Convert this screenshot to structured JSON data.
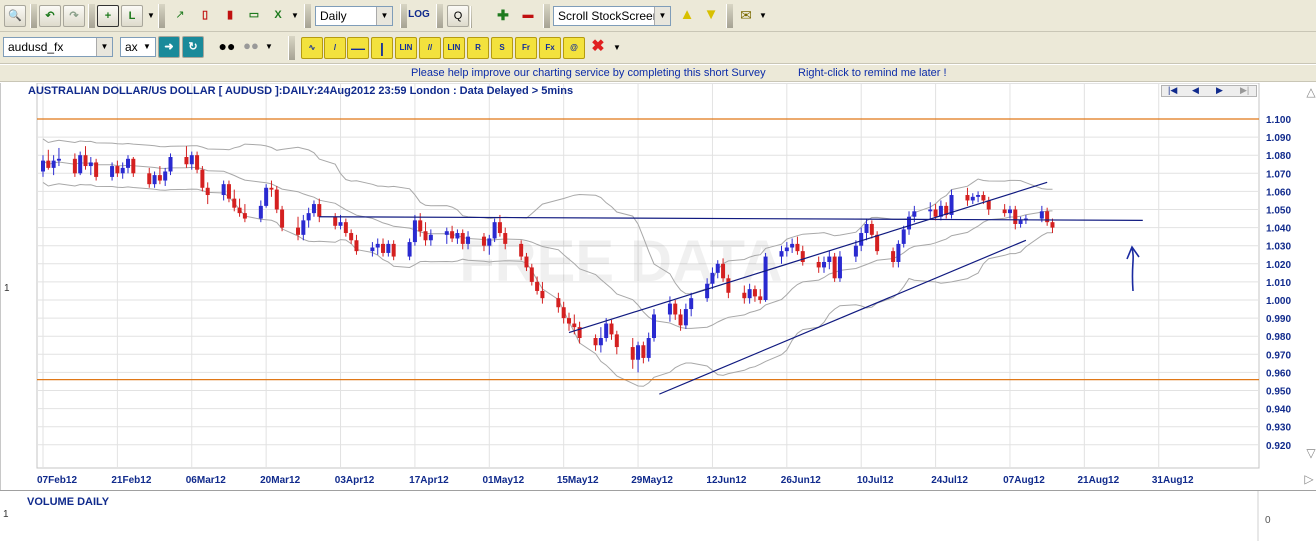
{
  "toolbar1": {
    "period_select": "Daily",
    "log_label": "LOG",
    "scroll_select": "Scroll StockScreen"
  },
  "toolbar2": {
    "symbol_input": "audusd_fx",
    "exchange_select": "ax",
    "draw_buttons": [
      "LIN",
      "LIN",
      "R",
      "S",
      "Fr",
      "Fx"
    ]
  },
  "survey": {
    "message": "Please help improve our charting service by completing this short Survey",
    "remind": "Right-click to remind me later !"
  },
  "chart": {
    "title": "AUSTRALIAN DOLLAR/US DOLLAR [ AUDUSD ]:DAILY:24Aug2012 23:59 London : Data Delayed > 5mins",
    "watermark": "FREE DATA",
    "left_marker": "1"
  },
  "volume": {
    "title": "VOLUME DAILY",
    "left_marker": "1",
    "right_value": "0"
  },
  "chart_data": {
    "type": "candlestick",
    "title": "AUSTRALIAN DOLLAR/US DOLLAR [ AUDUSD ]:DAILY:24Aug2012 23:59 London : Data Delayed > 5mins",
    "x_tick_labels": [
      "07Feb12",
      "21Feb12",
      "06Mar12",
      "20Mar12",
      "03Apr12",
      "17Apr12",
      "01May12",
      "15May12",
      "29May12",
      "12Jun12",
      "26Jun12",
      "10Jul12",
      "24Jul12",
      "07Aug12",
      "21Aug12",
      "31Aug12"
    ],
    "y_tick_labels": [
      "1.100",
      "1.090",
      "1.080",
      "1.070",
      "1.060",
      "1.050",
      "1.040",
      "1.030",
      "1.020",
      "1.010",
      "1.000",
      "0.990",
      "0.980",
      "0.970",
      "0.960",
      "0.950",
      "0.940",
      "0.930",
      "0.920"
    ],
    "ylim": [
      0.915,
      1.105
    ],
    "x_range_days": [
      0,
      210
    ],
    "grid": true,
    "up_color": "#2a2ad0",
    "down_color": "#d42020",
    "band_color": "#a8a8a8",
    "trendline_color": "#101a80",
    "level_color": "#e07818",
    "horizontal_levels": [
      1.1,
      0.956
    ],
    "trendlines": [
      {
        "x1": 99,
        "y1": 0.982,
        "x2": 189,
        "y2": 1.065
      },
      {
        "x1": 116,
        "y1": 0.948,
        "x2": 185,
        "y2": 1.033
      },
      {
        "x1": 52,
        "y1": 1.046,
        "x2": 207,
        "y2": 1.044
      }
    ],
    "ohlc": [
      {
        "t": 0,
        "o": 1.071,
        "h": 1.08,
        "l": 1.068,
        "c": 1.077
      },
      {
        "t": 1,
        "o": 1.077,
        "h": 1.083,
        "l": 1.072,
        "c": 1.073
      },
      {
        "t": 2,
        "o": 1.073,
        "h": 1.08,
        "l": 1.069,
        "c": 1.077
      },
      {
        "t": 3,
        "o": 1.077,
        "h": 1.084,
        "l": 1.074,
        "c": 1.078
      },
      {
        "t": 6,
        "o": 1.078,
        "h": 1.081,
        "l": 1.068,
        "c": 1.07
      },
      {
        "t": 7,
        "o": 1.07,
        "h": 1.082,
        "l": 1.069,
        "c": 1.08
      },
      {
        "t": 8,
        "o": 1.08,
        "h": 1.085,
        "l": 1.072,
        "c": 1.074
      },
      {
        "t": 9,
        "o": 1.074,
        "h": 1.079,
        "l": 1.069,
        "c": 1.076
      },
      {
        "t": 10,
        "o": 1.076,
        "h": 1.078,
        "l": 1.066,
        "c": 1.068
      },
      {
        "t": 13,
        "o": 1.068,
        "h": 1.076,
        "l": 1.066,
        "c": 1.074
      },
      {
        "t": 14,
        "o": 1.074,
        "h": 1.077,
        "l": 1.068,
        "c": 1.07
      },
      {
        "t": 15,
        "o": 1.07,
        "h": 1.076,
        "l": 1.067,
        "c": 1.073
      },
      {
        "t": 16,
        "o": 1.073,
        "h": 1.08,
        "l": 1.07,
        "c": 1.078
      },
      {
        "t": 17,
        "o": 1.078,
        "h": 1.079,
        "l": 1.068,
        "c": 1.07
      },
      {
        "t": 20,
        "o": 1.07,
        "h": 1.073,
        "l": 1.062,
        "c": 1.064
      },
      {
        "t": 21,
        "o": 1.064,
        "h": 1.071,
        "l": 1.062,
        "c": 1.069
      },
      {
        "t": 22,
        "o": 1.069,
        "h": 1.074,
        "l": 1.064,
        "c": 1.066
      },
      {
        "t": 23,
        "o": 1.066,
        "h": 1.073,
        "l": 1.063,
        "c": 1.071
      },
      {
        "t": 24,
        "o": 1.071,
        "h": 1.081,
        "l": 1.069,
        "c": 1.079
      },
      {
        "t": 27,
        "o": 1.079,
        "h": 1.085,
        "l": 1.073,
        "c": 1.075
      },
      {
        "t": 28,
        "o": 1.075,
        "h": 1.082,
        "l": 1.072,
        "c": 1.08
      },
      {
        "t": 29,
        "o": 1.08,
        "h": 1.082,
        "l": 1.07,
        "c": 1.072
      },
      {
        "t": 30,
        "o": 1.072,
        "h": 1.074,
        "l": 1.06,
        "c": 1.062
      },
      {
        "t": 31,
        "o": 1.062,
        "h": 1.065,
        "l": 1.053,
        "c": 1.058
      },
      {
        "t": 34,
        "o": 1.058,
        "h": 1.066,
        "l": 1.055,
        "c": 1.064
      },
      {
        "t": 35,
        "o": 1.064,
        "h": 1.066,
        "l": 1.054,
        "c": 1.056
      },
      {
        "t": 36,
        "o": 1.056,
        "h": 1.061,
        "l": 1.049,
        "c": 1.051
      },
      {
        "t": 37,
        "o": 1.051,
        "h": 1.056,
        "l": 1.046,
        "c": 1.048
      },
      {
        "t": 38,
        "o": 1.048,
        "h": 1.053,
        "l": 1.043,
        "c": 1.045
      },
      {
        "t": 41,
        "o": 1.045,
        "h": 1.055,
        "l": 1.043,
        "c": 1.052
      },
      {
        "t": 42,
        "o": 1.052,
        "h": 1.064,
        "l": 1.051,
        "c": 1.062
      },
      {
        "t": 43,
        "o": 1.062,
        "h": 1.066,
        "l": 1.057,
        "c": 1.061
      },
      {
        "t": 44,
        "o": 1.061,
        "h": 1.063,
        "l": 1.048,
        "c": 1.05
      },
      {
        "t": 45,
        "o": 1.05,
        "h": 1.052,
        "l": 1.038,
        "c": 1.04
      },
      {
        "t": 48,
        "o": 1.04,
        "h": 1.046,
        "l": 1.033,
        "c": 1.036
      },
      {
        "t": 49,
        "o": 1.036,
        "h": 1.047,
        "l": 1.033,
        "c": 1.044
      },
      {
        "t": 50,
        "o": 1.044,
        "h": 1.051,
        "l": 1.04,
        "c": 1.048
      },
      {
        "t": 51,
        "o": 1.048,
        "h": 1.055,
        "l": 1.046,
        "c": 1.053
      },
      {
        "t": 52,
        "o": 1.053,
        "h": 1.056,
        "l": 1.043,
        "c": 1.046
      },
      {
        "t": 55,
        "o": 1.046,
        "h": 1.048,
        "l": 1.039,
        "c": 1.041
      },
      {
        "t": 56,
        "o": 1.041,
        "h": 1.047,
        "l": 1.039,
        "c": 1.043
      },
      {
        "t": 57,
        "o": 1.043,
        "h": 1.045,
        "l": 1.035,
        "c": 1.037
      },
      {
        "t": 58,
        "o": 1.037,
        "h": 1.039,
        "l": 1.031,
        "c": 1.033
      },
      {
        "t": 59,
        "o": 1.033,
        "h": 1.036,
        "l": 1.025,
        "c": 1.027
      },
      {
        "t": 62,
        "o": 1.027,
        "h": 1.032,
        "l": 1.024,
        "c": 1.029
      },
      {
        "t": 63,
        "o": 1.029,
        "h": 1.034,
        "l": 1.025,
        "c": 1.031
      },
      {
        "t": 64,
        "o": 1.031,
        "h": 1.034,
        "l": 1.024,
        "c": 1.026
      },
      {
        "t": 65,
        "o": 1.026,
        "h": 1.033,
        "l": 1.024,
        "c": 1.031
      },
      {
        "t": 66,
        "o": 1.031,
        "h": 1.033,
        "l": 1.022,
        "c": 1.024
      },
      {
        "t": 69,
        "o": 1.024,
        "h": 1.034,
        "l": 1.022,
        "c": 1.032
      },
      {
        "t": 70,
        "o": 1.032,
        "h": 1.047,
        "l": 1.03,
        "c": 1.044
      },
      {
        "t": 71,
        "o": 1.044,
        "h": 1.048,
        "l": 1.035,
        "c": 1.038
      },
      {
        "t": 72,
        "o": 1.038,
        "h": 1.043,
        "l": 1.03,
        "c": 1.033
      },
      {
        "t": 73,
        "o": 1.033,
        "h": 1.039,
        "l": 1.03,
        "c": 1.036
      },
      {
        "t": 76,
        "o": 1.036,
        "h": 1.04,
        "l": 1.031,
        "c": 1.038
      },
      {
        "t": 77,
        "o": 1.038,
        "h": 1.041,
        "l": 1.032,
        "c": 1.034
      },
      {
        "t": 78,
        "o": 1.034,
        "h": 1.039,
        "l": 1.031,
        "c": 1.037
      },
      {
        "t": 79,
        "o": 1.037,
        "h": 1.039,
        "l": 1.028,
        "c": 1.031
      },
      {
        "t": 80,
        "o": 1.031,
        "h": 1.038,
        "l": 1.028,
        "c": 1.035
      },
      {
        "t": 83,
        "o": 1.035,
        "h": 1.037,
        "l": 1.027,
        "c": 1.03
      },
      {
        "t": 84,
        "o": 1.03,
        "h": 1.036,
        "l": 1.025,
        "c": 1.034
      },
      {
        "t": 85,
        "o": 1.034,
        "h": 1.045,
        "l": 1.032,
        "c": 1.043
      },
      {
        "t": 86,
        "o": 1.043,
        "h": 1.047,
        "l": 1.035,
        "c": 1.037
      },
      {
        "t": 87,
        "o": 1.037,
        "h": 1.04,
        "l": 1.028,
        "c": 1.031
      },
      {
        "t": 90,
        "o": 1.031,
        "h": 1.033,
        "l": 1.022,
        "c": 1.024
      },
      {
        "t": 91,
        "o": 1.024,
        "h": 1.026,
        "l": 1.016,
        "c": 1.018
      },
      {
        "t": 92,
        "o": 1.018,
        "h": 1.02,
        "l": 1.008,
        "c": 1.01
      },
      {
        "t": 93,
        "o": 1.01,
        "h": 1.013,
        "l": 1.003,
        "c": 1.005
      },
      {
        "t": 94,
        "o": 1.005,
        "h": 1.01,
        "l": 0.998,
        "c": 1.001
      },
      {
        "t": 97,
        "o": 1.001,
        "h": 1.004,
        "l": 0.993,
        "c": 0.996
      },
      {
        "t": 98,
        "o": 0.996,
        "h": 0.999,
        "l": 0.987,
        "c": 0.99
      },
      {
        "t": 99,
        "o": 0.99,
        "h": 0.993,
        "l": 0.983,
        "c": 0.987
      },
      {
        "t": 100,
        "o": 0.987,
        "h": 0.992,
        "l": 0.981,
        "c": 0.985
      },
      {
        "t": 101,
        "o": 0.985,
        "h": 0.988,
        "l": 0.976,
        "c": 0.979
      },
      {
        "t": 104,
        "o": 0.979,
        "h": 0.981,
        "l": 0.972,
        "c": 0.975
      },
      {
        "t": 105,
        "o": 0.975,
        "h": 0.985,
        "l": 0.971,
        "c": 0.979
      },
      {
        "t": 106,
        "o": 0.979,
        "h": 0.99,
        "l": 0.977,
        "c": 0.987
      },
      {
        "t": 107,
        "o": 0.987,
        "h": 0.989,
        "l": 0.978,
        "c": 0.981
      },
      {
        "t": 108,
        "o": 0.981,
        "h": 0.983,
        "l": 0.97,
        "c": 0.974
      },
      {
        "t": 111,
        "o": 0.974,
        "h": 0.979,
        "l": 0.962,
        "c": 0.967
      },
      {
        "t": 112,
        "o": 0.967,
        "h": 0.977,
        "l": 0.96,
        "c": 0.975
      },
      {
        "t": 113,
        "o": 0.975,
        "h": 0.977,
        "l": 0.965,
        "c": 0.968
      },
      {
        "t": 114,
        "o": 0.968,
        "h": 0.982,
        "l": 0.966,
        "c": 0.979
      },
      {
        "t": 115,
        "o": 0.979,
        "h": 0.995,
        "l": 0.977,
        "c": 0.992
      },
      {
        "t": 118,
        "o": 0.992,
        "h": 1.002,
        "l": 0.988,
        "c": 0.998
      },
      {
        "t": 119,
        "o": 0.998,
        "h": 1.0,
        "l": 0.989,
        "c": 0.992
      },
      {
        "t": 120,
        "o": 0.992,
        "h": 0.995,
        "l": 0.983,
        "c": 0.986
      },
      {
        "t": 121,
        "o": 0.986,
        "h": 0.998,
        "l": 0.984,
        "c": 0.995
      },
      {
        "t": 122,
        "o": 0.995,
        "h": 1.004,
        "l": 0.991,
        "c": 1.001
      },
      {
        "t": 125,
        "o": 1.001,
        "h": 1.012,
        "l": 0.999,
        "c": 1.009
      },
      {
        "t": 126,
        "o": 1.009,
        "h": 1.018,
        "l": 1.006,
        "c": 1.015
      },
      {
        "t": 127,
        "o": 1.015,
        "h": 1.022,
        "l": 1.012,
        "c": 1.02
      },
      {
        "t": 128,
        "o": 1.02,
        "h": 1.023,
        "l": 1.01,
        "c": 1.012
      },
      {
        "t": 129,
        "o": 1.012,
        "h": 1.014,
        "l": 1.001,
        "c": 1.004
      },
      {
        "t": 132,
        "o": 1.004,
        "h": 1.008,
        "l": 0.998,
        "c": 1.001
      },
      {
        "t": 133,
        "o": 1.001,
        "h": 1.009,
        "l": 0.998,
        "c": 1.006
      },
      {
        "t": 134,
        "o": 1.006,
        "h": 1.008,
        "l": 0.999,
        "c": 1.002
      },
      {
        "t": 135,
        "o": 1.002,
        "h": 1.006,
        "l": 0.998,
        "c": 1.0
      },
      {
        "t": 136,
        "o": 1.0,
        "h": 1.026,
        "l": 0.999,
        "c": 1.024
      },
      {
        "t": 139,
        "o": 1.024,
        "h": 1.03,
        "l": 1.02,
        "c": 1.027
      },
      {
        "t": 140,
        "o": 1.027,
        "h": 1.032,
        "l": 1.024,
        "c": 1.029
      },
      {
        "t": 141,
        "o": 1.029,
        "h": 1.034,
        "l": 1.026,
        "c": 1.031
      },
      {
        "t": 142,
        "o": 1.031,
        "h": 1.035,
        "l": 1.025,
        "c": 1.027
      },
      {
        "t": 143,
        "o": 1.027,
        "h": 1.03,
        "l": 1.019,
        "c": 1.021
      },
      {
        "t": 146,
        "o": 1.021,
        "h": 1.024,
        "l": 1.015,
        "c": 1.018
      },
      {
        "t": 147,
        "o": 1.018,
        "h": 1.024,
        "l": 1.015,
        "c": 1.021
      },
      {
        "t": 148,
        "o": 1.021,
        "h": 1.027,
        "l": 1.017,
        "c": 1.024
      },
      {
        "t": 149,
        "o": 1.024,
        "h": 1.026,
        "l": 1.01,
        "c": 1.012
      },
      {
        "t": 150,
        "o": 1.012,
        "h": 1.027,
        "l": 1.01,
        "c": 1.024
      },
      {
        "t": 153,
        "o": 1.024,
        "h": 1.033,
        "l": 1.021,
        "c": 1.03
      },
      {
        "t": 154,
        "o": 1.03,
        "h": 1.04,
        "l": 1.027,
        "c": 1.037
      },
      {
        "t": 155,
        "o": 1.037,
        "h": 1.045,
        "l": 1.033,
        "c": 1.042
      },
      {
        "t": 156,
        "o": 1.042,
        "h": 1.044,
        "l": 1.034,
        "c": 1.036
      },
      {
        "t": 157,
        "o": 1.036,
        "h": 1.038,
        "l": 1.025,
        "c": 1.027
      },
      {
        "t": 160,
        "o": 1.027,
        "h": 1.029,
        "l": 1.018,
        "c": 1.021
      },
      {
        "t": 161,
        "o": 1.021,
        "h": 1.033,
        "l": 1.018,
        "c": 1.031
      },
      {
        "t": 162,
        "o": 1.031,
        "h": 1.041,
        "l": 1.029,
        "c": 1.039
      },
      {
        "t": 163,
        "o": 1.039,
        "h": 1.049,
        "l": 1.036,
        "c": 1.046
      },
      {
        "t": 164,
        "o": 1.046,
        "h": 1.052,
        "l": 1.043,
        "c": 1.049
      },
      {
        "t": 167,
        "o": 1.049,
        "h": 1.054,
        "l": 1.045,
        "c": 1.05
      },
      {
        "t": 168,
        "o": 1.05,
        "h": 1.053,
        "l": 1.044,
        "c": 1.046
      },
      {
        "t": 169,
        "o": 1.046,
        "h": 1.055,
        "l": 1.044,
        "c": 1.052
      },
      {
        "t": 170,
        "o": 1.052,
        "h": 1.054,
        "l": 1.045,
        "c": 1.047
      },
      {
        "t": 171,
        "o": 1.047,
        "h": 1.061,
        "l": 1.045,
        "c": 1.058
      },
      {
        "t": 174,
        "o": 1.058,
        "h": 1.062,
        "l": 1.052,
        "c": 1.055
      },
      {
        "t": 175,
        "o": 1.055,
        "h": 1.059,
        "l": 1.053,
        "c": 1.057
      },
      {
        "t": 176,
        "o": 1.057,
        "h": 1.06,
        "l": 1.054,
        "c": 1.058
      },
      {
        "t": 177,
        "o": 1.058,
        "h": 1.06,
        "l": 1.053,
        "c": 1.055
      },
      {
        "t": 178,
        "o": 1.055,
        "h": 1.057,
        "l": 1.047,
        "c": 1.05
      },
      {
        "t": 181,
        "o": 1.05,
        "h": 1.053,
        "l": 1.046,
        "c": 1.048
      },
      {
        "t": 182,
        "o": 1.048,
        "h": 1.052,
        "l": 1.045,
        "c": 1.05
      },
      {
        "t": 183,
        "o": 1.05,
        "h": 1.052,
        "l": 1.039,
        "c": 1.042
      },
      {
        "t": 184,
        "o": 1.042,
        "h": 1.046,
        "l": 1.04,
        "c": 1.044
      },
      {
        "t": 185,
        "o": 1.044,
        "h": 1.047,
        "l": 1.042,
        "c": 1.045
      },
      {
        "t": 188,
        "o": 1.045,
        "h": 1.052,
        "l": 1.043,
        "c": 1.049
      },
      {
        "t": 189,
        "o": 1.049,
        "h": 1.051,
        "l": 1.041,
        "c": 1.043
      },
      {
        "t": 190,
        "o": 1.043,
        "h": 1.045,
        "l": 1.037,
        "c": 1.04
      }
    ]
  }
}
